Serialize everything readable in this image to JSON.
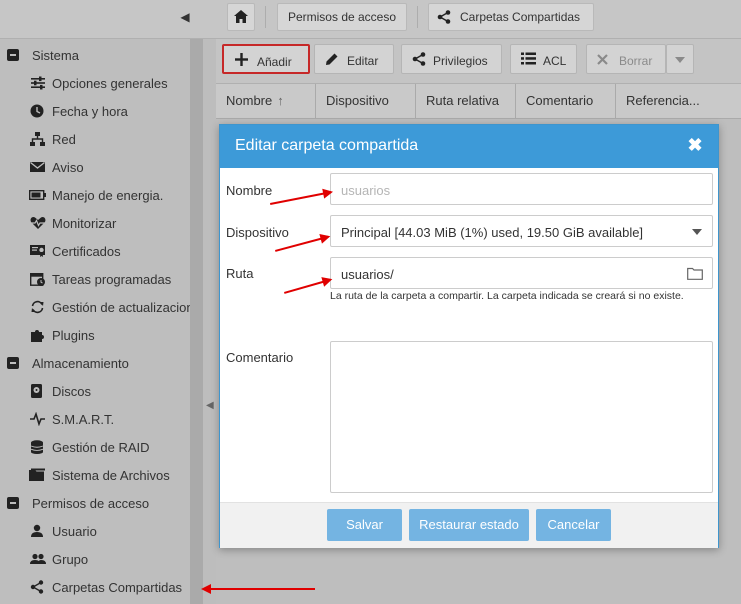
{
  "breadcrumb": [
    "Permisos de acceso",
    "Carpetas Compartidas"
  ],
  "sidebar": {
    "groups": [
      {
        "label": "Sistema",
        "items": [
          {
            "label": "Opciones generales",
            "icon": "sliders-icon"
          },
          {
            "label": "Fecha y hora",
            "icon": "clock-icon"
          },
          {
            "label": "Red",
            "icon": "network-icon"
          },
          {
            "label": "Aviso",
            "icon": "envelope-icon"
          },
          {
            "label": "Manejo de energia.",
            "icon": "battery-icon"
          },
          {
            "label": "Monitorizar",
            "icon": "heartbeat-icon"
          },
          {
            "label": "Certificados",
            "icon": "certificate-icon"
          },
          {
            "label": "Tareas programadas",
            "icon": "calendar-clock-icon"
          },
          {
            "label": "Gestión de actualizacion",
            "icon": "refresh-icon"
          },
          {
            "label": "Plugins",
            "icon": "puzzle-icon"
          }
        ]
      },
      {
        "label": "Almacenamiento",
        "items": [
          {
            "label": "Discos",
            "icon": "disk-icon"
          },
          {
            "label": "S.M.A.R.T.",
            "icon": "pulse-icon"
          },
          {
            "label": "Gestión de RAID",
            "icon": "database-icon"
          },
          {
            "label": "Sistema de Archivos",
            "icon": "folder-icon"
          }
        ]
      },
      {
        "label": "Permisos de acceso",
        "items": [
          {
            "label": "Usuario",
            "icon": "user-icon"
          },
          {
            "label": "Grupo",
            "icon": "group-icon"
          },
          {
            "label": "Carpetas Compartidas",
            "icon": "share-icon"
          }
        ]
      }
    ]
  },
  "toolbar": {
    "add": "Añadir",
    "edit": "Editar",
    "privileges": "Privilegios",
    "acl": "ACL",
    "delete": "Borrar"
  },
  "grid": {
    "columns": [
      "Nombre",
      "Dispositivo",
      "Ruta relativa",
      "Comentario",
      "Referencia..."
    ]
  },
  "dialog": {
    "title": "Editar carpeta compartida",
    "fields": {
      "name_label": "Nombre",
      "name_placeholder": "usuarios",
      "device_label": "Dispositivo",
      "device_value": "Principal [44.03 MiB (1%) used, 19.50 GiB available]",
      "path_label": "Ruta",
      "path_value": "usuarios/",
      "path_hint": "La ruta de la carpeta a compartir. La carpeta indicada se creará si no existe.",
      "comment_label": "Comentario"
    },
    "buttons": {
      "save": "Salvar",
      "reset": "Restaurar estado",
      "cancel": "Cancelar"
    }
  },
  "colors": {
    "accent": "#3d9ad8",
    "button": "#74b4e2",
    "annotation": "#e00000"
  }
}
